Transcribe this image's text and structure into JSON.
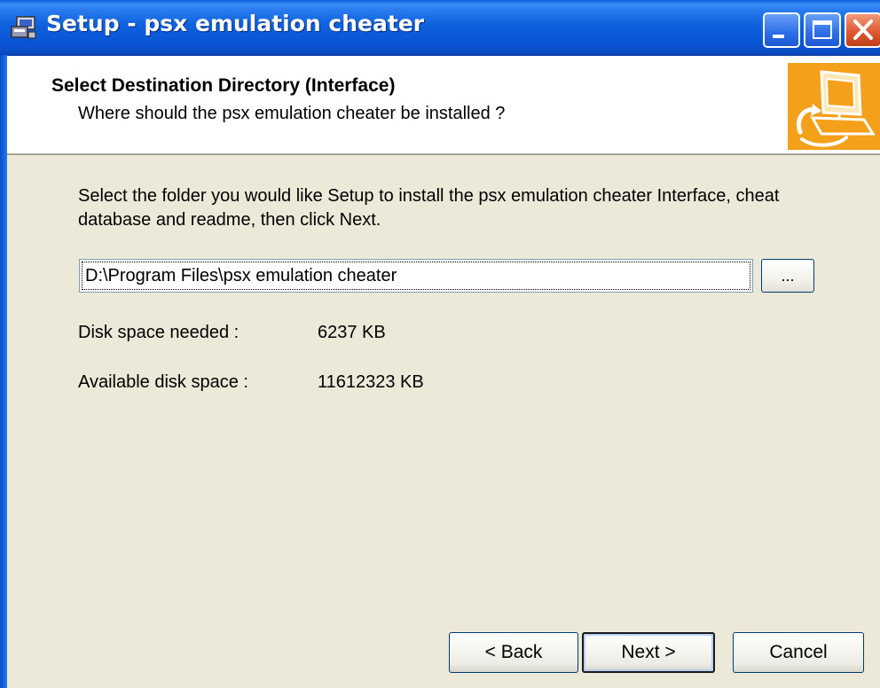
{
  "window": {
    "title": "Setup - psx emulation cheater",
    "app_icon": "installer-icon",
    "caption_buttons": [
      "minimize-icon",
      "maximize-icon",
      "close-icon"
    ]
  },
  "header": {
    "title": "Select Destination Directory (Interface)",
    "subtitle": "Where should the psx emulation cheater be installed ?",
    "image": "computer-install-icon"
  },
  "body": {
    "instruction": "Select the folder you would like Setup to install the psx emulation cheater Interface, cheat database and readme, then click Next.",
    "path_value": "D:\\Program Files\\psx emulation cheater",
    "browse_label": "...",
    "disk_needed_label": "Disk space needed :",
    "disk_needed_value": "6237 KB",
    "disk_available_label": "Available disk space :",
    "disk_available_value": "11612323 KB"
  },
  "buttons": {
    "back": "< Back",
    "next": "Next >",
    "cancel": "Cancel"
  },
  "colors": {
    "titlebar": "#0a5ddc",
    "dialog_bg": "#ece9d8",
    "header_image_bg": "#f5a01a",
    "close_button": "#e05a32"
  }
}
